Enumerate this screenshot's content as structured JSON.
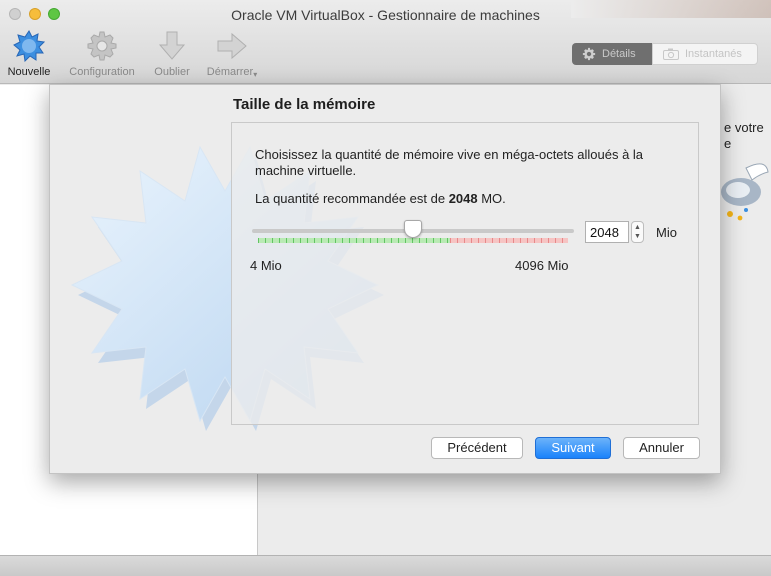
{
  "window": {
    "title": "Oracle VM VirtualBox - Gestionnaire de machines"
  },
  "toolbar": {
    "new_label": "Nouvelle",
    "settings_label": "Configuration",
    "discard_label": "Oublier",
    "start_label": "Démarrer"
  },
  "view_toggle": {
    "details_label": "Détails",
    "snapshots_label": "Instantanés"
  },
  "background_pane": {
    "partial_text_1": "e votre",
    "partial_text_2": "e"
  },
  "dialog": {
    "title": "Taille de la mémoire",
    "description": "Choisissez la quantité de mémoire vive en méga-octets alloués à la machine virtuelle.",
    "recommended_prefix": "La quantité recommandée est de ",
    "recommended_value": "2048",
    "recommended_suffix": " MO.",
    "slider": {
      "min": 4,
      "max": 4096,
      "value": 2048,
      "recommended_zone_end_fraction": 0.62,
      "caution_zone_end_fraction": 1.0
    },
    "min_label": "4 Mio",
    "max_label": "4096 Mio",
    "memory_value": "2048",
    "unit_label": "Mio",
    "buttons": {
      "back": "Précédent",
      "next": "Suivant",
      "cancel": "Annuler"
    }
  },
  "colors": {
    "accent_button": "#1a82fb",
    "ok_zone": "#b9eab4",
    "warn_zone": "#f6c4c3",
    "star": "#bcd8f2"
  }
}
